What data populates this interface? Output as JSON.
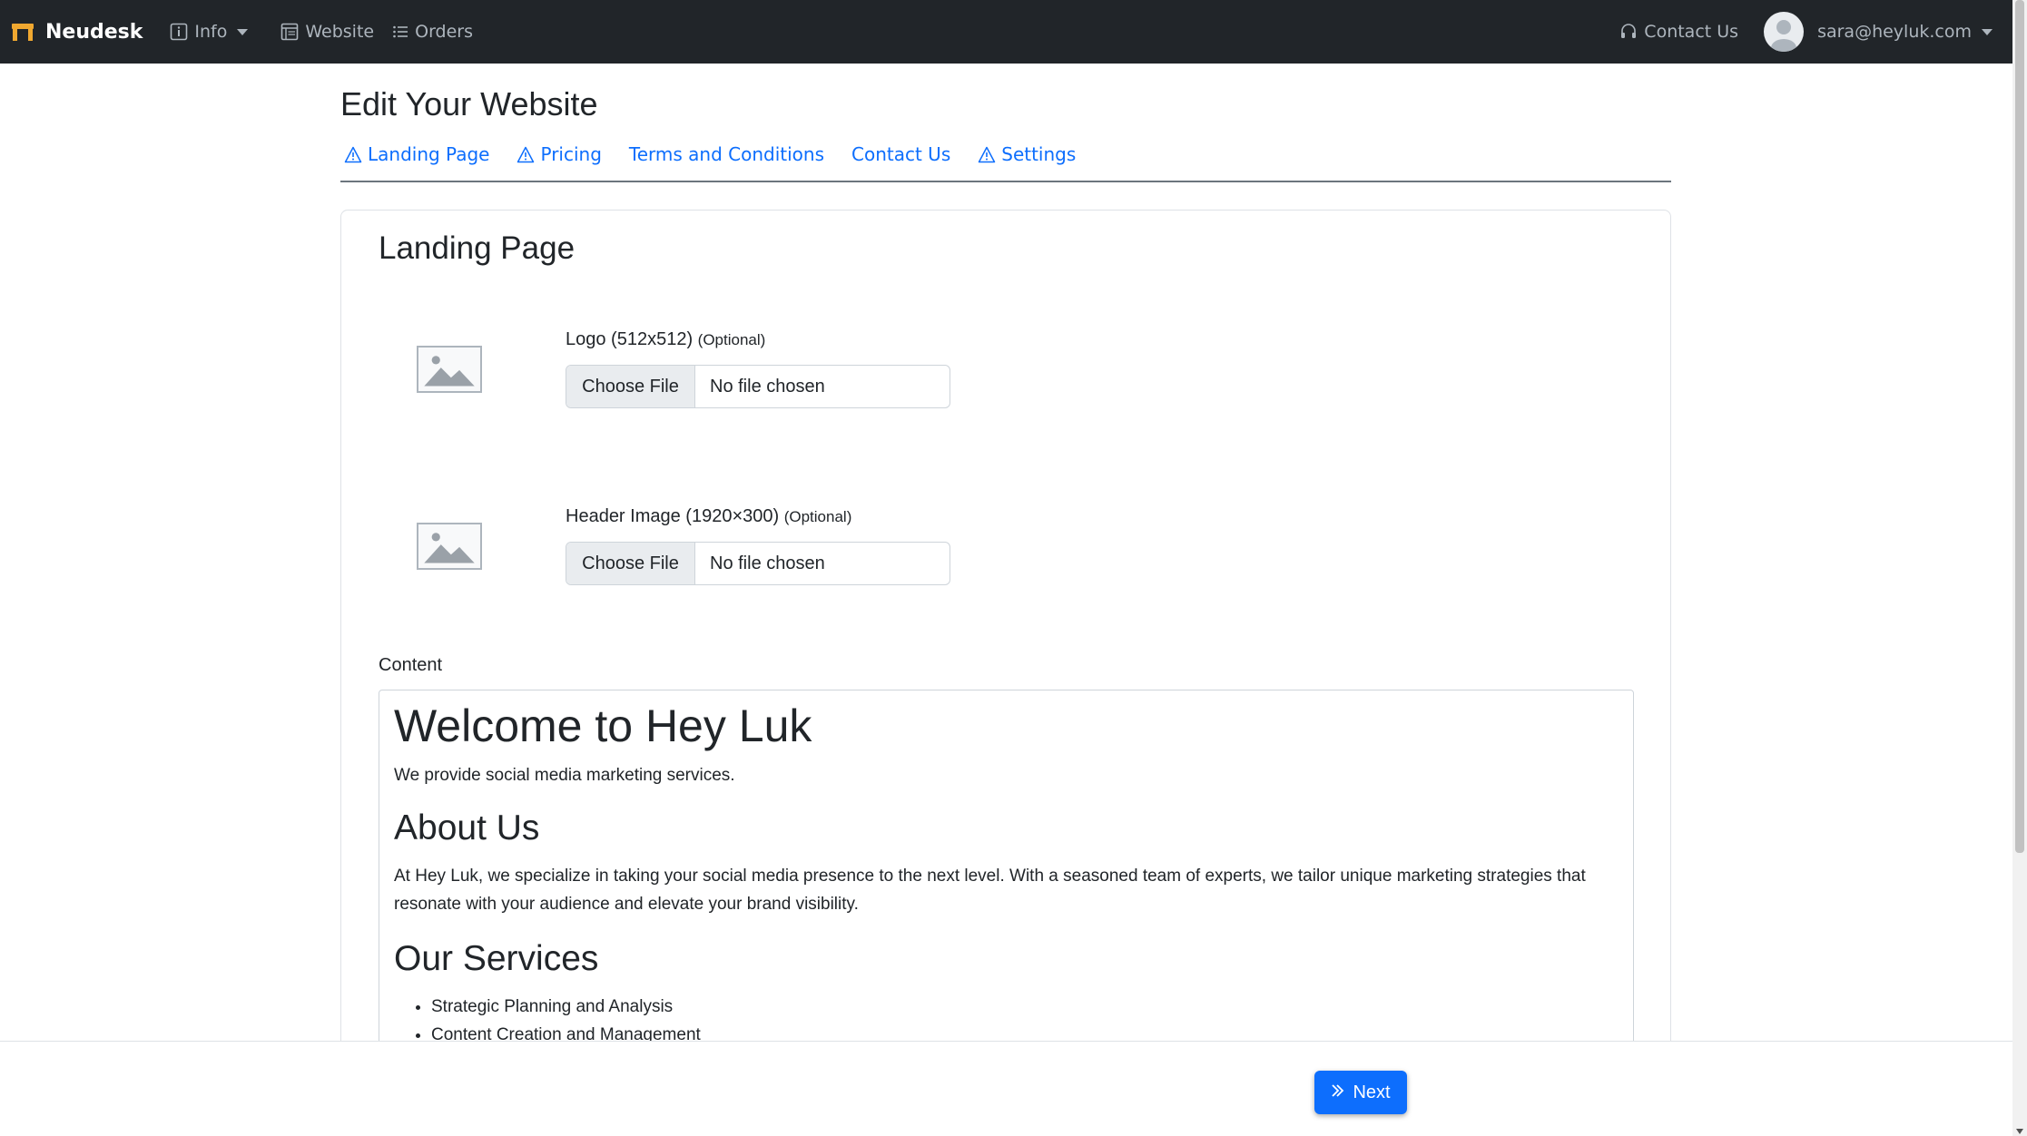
{
  "navbar": {
    "brand": "Neudesk",
    "info_label": "Info",
    "website_label": "Website",
    "orders_label": "Orders",
    "contact_label": "Contact Us",
    "user_email": "sara@heyluk.com"
  },
  "page": {
    "title": "Edit Your Website"
  },
  "tabs": [
    {
      "label": "Landing Page",
      "warning": true
    },
    {
      "label": "Pricing",
      "warning": true
    },
    {
      "label": "Terms and Conditions",
      "warning": false
    },
    {
      "label": "Contact Us",
      "warning": false
    },
    {
      "label": "Settings",
      "warning": true
    }
  ],
  "card": {
    "title": "Landing Page",
    "logo": {
      "label": "Logo (512x512)",
      "optional": "(Optional)",
      "button": "Choose File",
      "status": "No file chosen"
    },
    "header_image": {
      "label": "Header Image (1920×300)",
      "optional": "(Optional)",
      "button": "Choose File",
      "status": "No file chosen"
    },
    "content_label": "Content",
    "editor": {
      "heading": "Welcome to Hey Luk",
      "intro": "We provide social media marketing services.",
      "about_heading": "About Us",
      "about_text": "At Hey Luk, we specialize in taking your social media presence to the next level. With a seasoned team of experts, we tailor unique marketing strategies that resonate with your audience and elevate your brand visibility.",
      "services_heading": "Our Services",
      "services": [
        "Strategic Planning and Analysis",
        "Content Creation and Management"
      ]
    }
  },
  "footer": {
    "next_label": "Next"
  },
  "colors": {
    "navbar_bg": "#212529",
    "link": "#0d6efd",
    "primary_button": "#0d6efd"
  }
}
